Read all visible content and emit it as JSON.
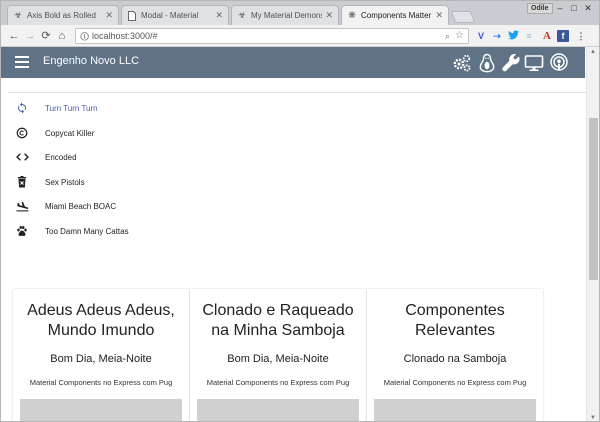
{
  "browser": {
    "tabs": [
      {
        "label": "Axis Bold as Rolled",
        "icon": "biohazard-icon"
      },
      {
        "label": "Modal - Material",
        "icon": "page-icon"
      },
      {
        "label": "My Material Demons",
        "icon": "biohazard-icon"
      },
      {
        "label": "Components Matter",
        "icon": "snowflake-icon"
      }
    ],
    "active_tab": 3,
    "profile": "Odile",
    "url": "localhost:3000/#",
    "extensions": [
      "vuetify-icon",
      "arrow-icon",
      "twitter-icon",
      "bookmark-icon",
      "font-icon",
      "facebook-icon",
      "menu-dots-icon"
    ]
  },
  "appbar": {
    "title": "Engenho Novo LLC",
    "icons": [
      "cogs-icon",
      "linux-icon",
      "wrench-icon",
      "desktop-icon",
      "podcast-icon"
    ],
    "color": "#5f7286"
  },
  "nav": {
    "items": [
      {
        "label": "Turn Turn Turn",
        "icon": "sync-icon",
        "active": true
      },
      {
        "label": "Copycat Killer",
        "icon": "copyright-icon"
      },
      {
        "label": "Encoded",
        "icon": "code-icon"
      },
      {
        "label": "Sex Pistols",
        "icon": "trash-icon"
      },
      {
        "label": "Miami Beach BOAC",
        "icon": "flight-land-icon"
      },
      {
        "label": "Too Damn Many Cattas",
        "icon": "paw-icon"
      }
    ],
    "active_color": "#4a5fa8"
  },
  "cards": [
    {
      "title_line1": "Adeus Adeus Adeus,",
      "title_line2": "Mundo Imundo",
      "subtitle": "Bom Dia, Meia-Noite",
      "text": "Material Components no Express com Pug"
    },
    {
      "title_line1": "Clonado e Raqueado",
      "title_line2": "na Minha Samboja",
      "subtitle": "Bom Dia, Meia-Noite",
      "text": "Material Components no Express com Pug"
    },
    {
      "title_line1": "Componentes",
      "title_line2": "Relevantes",
      "subtitle": "Clonado na Samboja",
      "text": "Material Components no Express com Pug"
    }
  ]
}
